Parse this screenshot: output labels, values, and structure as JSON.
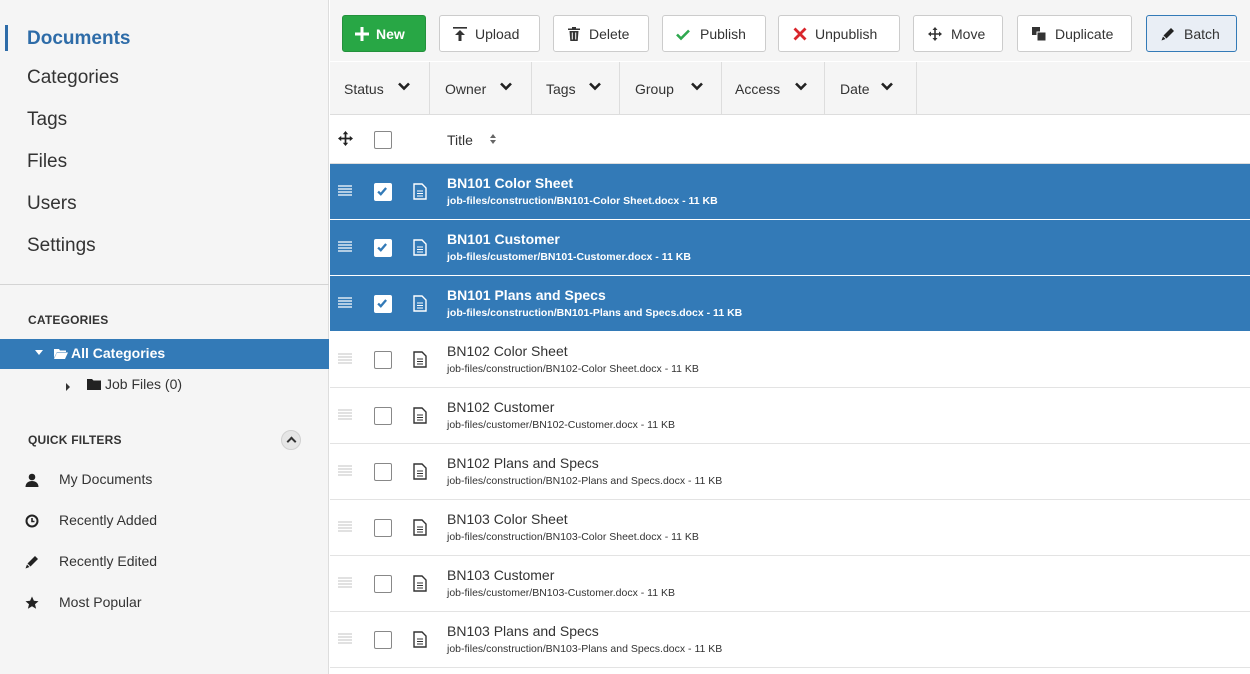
{
  "nav": [
    "Documents",
    "Categories",
    "Tags",
    "Files",
    "Users",
    "Settings"
  ],
  "categories": {
    "heading": "CATEGORIES",
    "all_label": "All Categories",
    "child_label": "Job Files (0)"
  },
  "quick_filters": {
    "heading": "QUICK FILTERS",
    "items": [
      "My Documents",
      "Recently Added",
      "Recently Edited",
      "Most Popular"
    ]
  },
  "toolbar": {
    "new": "New",
    "upload": "Upload",
    "delete": "Delete",
    "publish": "Publish",
    "unpublish": "Unpublish",
    "move": "Move",
    "duplicate": "Duplicate",
    "batch": "Batch"
  },
  "filters": [
    "Status",
    "Owner",
    "Tags",
    "Group",
    "Access",
    "Date"
  ],
  "table": {
    "title_header": "Title",
    "rows": [
      {
        "title": "BN101 Color Sheet",
        "path": "job-files/construction/BN101-Color Sheet.docx - 11 KB",
        "selected": true
      },
      {
        "title": "BN101 Customer",
        "path": "job-files/customer/BN101-Customer.docx - 11 KB",
        "selected": true
      },
      {
        "title": "BN101 Plans and Specs",
        "path": "job-files/construction/BN101-Plans and Specs.docx - 11 KB",
        "selected": true
      },
      {
        "title": "BN102 Color Sheet",
        "path": "job-files/construction/BN102-Color Sheet.docx - 11 KB",
        "selected": false
      },
      {
        "title": "BN102 Customer",
        "path": "job-files/customer/BN102-Customer.docx - 11 KB",
        "selected": false
      },
      {
        "title": "BN102 Plans and Specs",
        "path": "job-files/construction/BN102-Plans and Specs.docx - 11 KB",
        "selected": false
      },
      {
        "title": "BN103 Color Sheet",
        "path": "job-files/construction/BN103-Color Sheet.docx - 11 KB",
        "selected": false
      },
      {
        "title": "BN103 Customer",
        "path": "job-files/customer/BN103-Customer.docx - 11 KB",
        "selected": false
      },
      {
        "title": "BN103 Plans and Specs",
        "path": "job-files/construction/BN103-Plans and Specs.docx - 11 KB",
        "selected": false
      }
    ]
  },
  "colors": {
    "accent": "#337ab7",
    "new_button": "#28a745",
    "unpublish_x": "#d9262c",
    "publish_check": "#2fa84f"
  }
}
